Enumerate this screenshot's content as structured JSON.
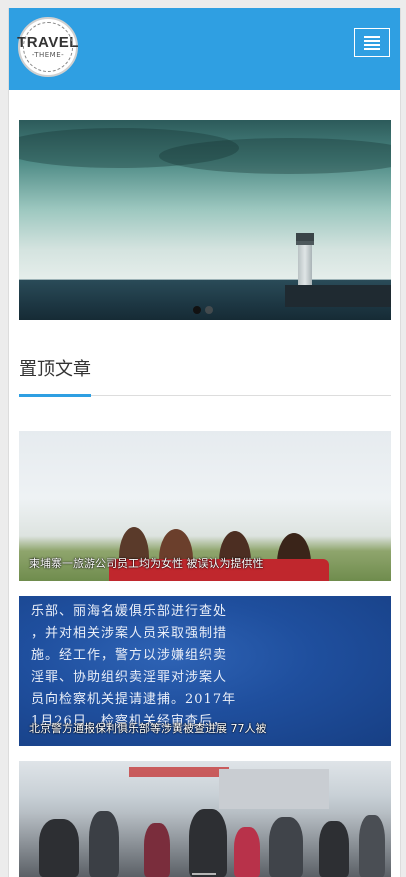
{
  "header": {
    "logo_main": "TRAVEL",
    "logo_sub": "-THEME-",
    "menu_icon": "hamburger-icon",
    "background_color": "#2f9fe2"
  },
  "slider": {
    "slide_count": 2,
    "active_index": 0
  },
  "section": {
    "title": "置顶文章",
    "accent_color": "#2f9fe2"
  },
  "articles": [
    {
      "caption": "柬埔寨一旅游公司员工均为女性 被误认为提供性"
    },
    {
      "caption": "北京警方通报保利俱乐部等涉黄被查进展 77人被",
      "image_text": [
        "乐部、丽海名媛俱乐部进行查处",
        "，并对相关涉案人员采取强制措",
        "施。经工作，警方以涉嫌组织卖",
        "淫罪、协助组织卖淫罪对涉案人",
        "员向检察机关提请逮捕。2017年",
        "1月26日，检察机关经审查后，"
      ]
    },
    {
      "caption": ""
    }
  ]
}
